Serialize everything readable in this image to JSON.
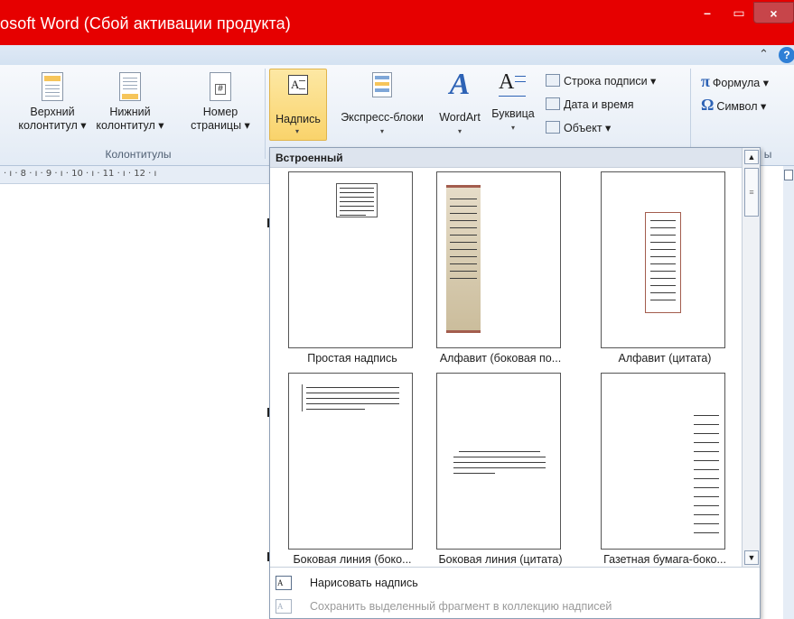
{
  "window": {
    "title": "osoft Word (Сбой активации продукта)",
    "controls": {
      "minimize": "–",
      "maximize": "▭",
      "close": "×"
    }
  },
  "tabs_row": {
    "collapse_glyph": "⌃",
    "help_glyph": "?"
  },
  "ribbon": {
    "header_footer_group": {
      "label": "Колонтитулы",
      "buttons": [
        {
          "line1": "Верхний",
          "line2": "колонтитул ▾"
        },
        {
          "line1": "Нижний",
          "line2": "колонтитул ▾"
        },
        {
          "line1": "Номер",
          "line2": "страницы ▾"
        }
      ]
    },
    "text_group": {
      "buttons": [
        {
          "label": "Надпись",
          "dropdown": "▾"
        },
        {
          "label": "Экспресс-блоки",
          "dropdown": "▾"
        },
        {
          "label": "WordArt",
          "dropdown": "▾"
        },
        {
          "label": "Буквица",
          "dropdown": "▾"
        }
      ],
      "small": [
        {
          "label": "Строка подписи ▾",
          "icon": "signature-line-icon"
        },
        {
          "label": "Дата и время",
          "icon": "date-time-icon"
        },
        {
          "label": "Объект ▾",
          "icon": "object-icon"
        }
      ],
      "partial_label": "ы"
    },
    "symbols_group": {
      "formula": {
        "glyph": "π",
        "label": "Формула ▾"
      },
      "symbol": {
        "glyph": "Ω",
        "label": "Символ ▾"
      }
    }
  },
  "ruler": {
    "text": "· ı · 8 · ı · 9 · ı · 10 · ı · 11 · ı · 12 · ı"
  },
  "gallery": {
    "header": "Встроенный",
    "items": [
      {
        "label": "Простая надпись"
      },
      {
        "label": "Алфавит (боковая по..."
      },
      {
        "label": "Алфавит (цитата)"
      },
      {
        "label": "Боковая линия (боко..."
      },
      {
        "label": "Боковая линия (цитата)"
      },
      {
        "label": "Газетная бумага-боко..."
      }
    ],
    "scroll": {
      "up": "▲",
      "down": "▼",
      "more": "≡"
    },
    "menu": [
      {
        "label": "Нарисовать надпись",
        "enabled": true,
        "icon_text": "A"
      },
      {
        "label": "Сохранить выделенный фрагмент в коллекцию надписей",
        "enabled": false,
        "icon_text": "A"
      }
    ]
  },
  "colors": {
    "title_bar": "#e60000",
    "close_button": "#c7454a",
    "selected_button": "#f9d36b",
    "gallery_header": "#dde4ee"
  }
}
